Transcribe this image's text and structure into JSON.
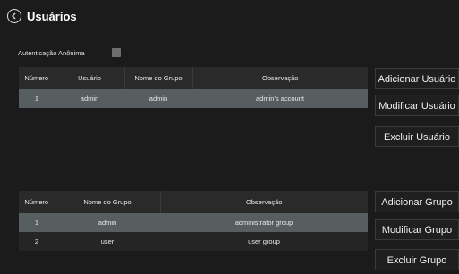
{
  "header": {
    "title": "Usuários",
    "back_icon": "back-arrow-icon"
  },
  "anonymous": {
    "label": "Autenticação Anônima",
    "checked": false
  },
  "users": {
    "columns": [
      "Número",
      "Usuário",
      "Nome do Grupo",
      "Observação"
    ],
    "rows": [
      {
        "number": "1",
        "user": "admin",
        "group": "admin",
        "note": "admin's account",
        "selected": true
      }
    ]
  },
  "groups": {
    "columns": [
      "Número",
      "Nome do Grupo",
      "Observação"
    ],
    "rows": [
      {
        "number": "1",
        "group": "admin",
        "note": "administrator group",
        "selected": true
      },
      {
        "number": "2",
        "group": "user",
        "note": "user group",
        "selected": false
      }
    ]
  },
  "user_buttons": {
    "add": "Adicionar Usuário",
    "modify": "Modificar Usuário",
    "delete": "Excluir Usuário"
  },
  "group_buttons": {
    "add": "Adicionar Grupo",
    "modify": "Modificar Grupo",
    "delete": "Excluir Grupo"
  },
  "colors": {
    "background": "#1b1b1b",
    "selected_row": "#565e60",
    "header_row": "#2a2a2a"
  }
}
